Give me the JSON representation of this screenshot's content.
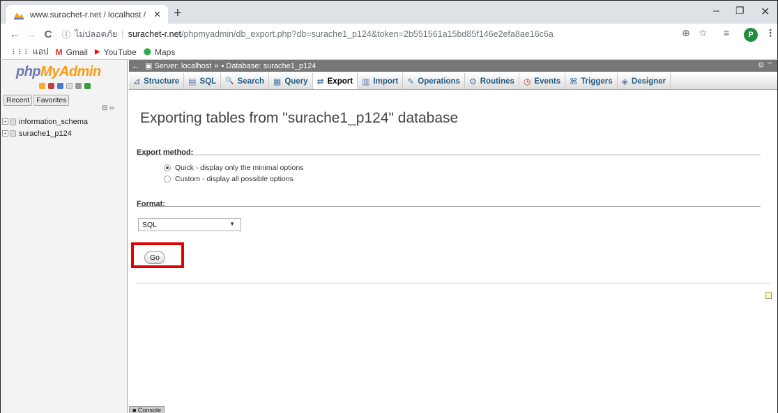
{
  "browser": {
    "tab_title": "www.surachet-r.net / localhost / ",
    "tab_close": "✕",
    "new_tab": "+",
    "window_controls": {
      "minimize": "–",
      "maximize": "❐",
      "close": "✕"
    },
    "address": {
      "info_icon": "ⓘ",
      "security_label": "ไม่ปลอดภัย",
      "separator": "|",
      "host": "surachet-r.net",
      "path": "/phpmyadmin/db_export.php?db=surache1_p124&token=2b551561a15bd85f146e2efa8ae16c6a"
    },
    "nav": {
      "back": "←",
      "forward": "→",
      "reload": "C"
    },
    "right_icons": {
      "zoom": "⊕",
      "star": "☆",
      "ext": "≡"
    },
    "avatar_letter": "P",
    "menu": "⋮",
    "bookmarks": [
      {
        "icon": "⋮⋮⋮",
        "label": "แอป",
        "color": "#1a73e8"
      },
      {
        "icon": "M",
        "label": "Gmail",
        "color": "#d93025"
      },
      {
        "icon": "▶",
        "label": "YouTube",
        "color": "#ff0000"
      },
      {
        "icon": "⬤",
        "label": "Maps",
        "color": "#34a853"
      }
    ]
  },
  "nav_panel": {
    "logo_php": "php",
    "logo_myadmin": "MyAdmin",
    "recent": "Recent",
    "favorites": "Favorites",
    "collapse": "⊟ ∞",
    "databases": [
      {
        "name": "information_schema"
      },
      {
        "name": "surache1_p124"
      }
    ]
  },
  "breadcrumb": {
    "arrow": "←",
    "server": "Server: localhost",
    "sep": "»",
    "database": "Database: surache1_p124",
    "right": "⚙ ⌃"
  },
  "menu_tabs": [
    {
      "icon": "⊿",
      "label": "Structure",
      "active": false
    },
    {
      "icon": "▤",
      "label": "SQL",
      "active": false
    },
    {
      "icon": "🔍",
      "label": "Search",
      "active": false
    },
    {
      "icon": "▦",
      "label": "Query",
      "active": false
    },
    {
      "icon": "⇄",
      "label": "Export",
      "active": true
    },
    {
      "icon": "▥",
      "label": "Import",
      "active": false
    },
    {
      "icon": "✎",
      "label": "Operations",
      "active": false
    },
    {
      "icon": "⚙",
      "label": "Routines",
      "active": false
    },
    {
      "icon": "◷",
      "label": "Events",
      "active": false
    },
    {
      "icon": "⌘",
      "label": "Triggers",
      "active": false
    },
    {
      "icon": "◈",
      "label": "Designer",
      "active": false
    }
  ],
  "export": {
    "title": "Exporting tables from \"surache1_p124\" database",
    "method_label": "Export method:",
    "quick_option": "Quick - display only the minimal options",
    "custom_option": "Custom - display all possible options",
    "selected_method": "quick",
    "format_label": "Format:",
    "format_value": "SQL",
    "go_label": "Go"
  },
  "console_label": "■ Console",
  "colors": {
    "highlight": "#e30000",
    "link": "#235a81",
    "serverbar": "#777777"
  }
}
